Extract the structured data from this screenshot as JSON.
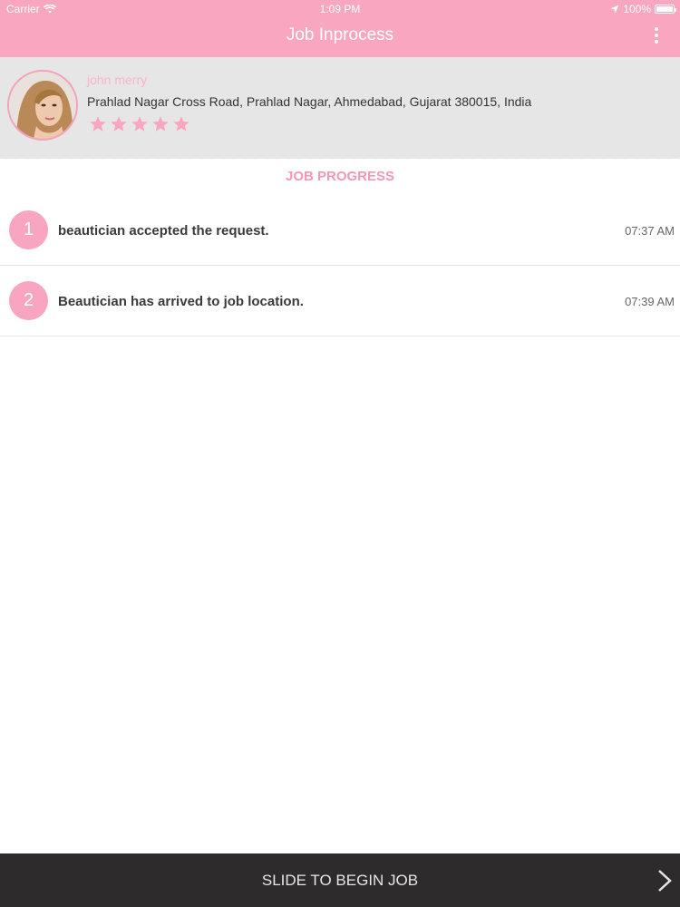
{
  "status_bar": {
    "carrier": "Carrier",
    "time": "1:09 PM",
    "battery": "100%"
  },
  "header": {
    "title": "Job Inprocess",
    "menu_icon": "more-vertical-icon"
  },
  "profile": {
    "name": "john merry",
    "address": "Prahlad Nagar Cross Road,  Prahlad Nagar,  Ahmedabad,  Gujarat 380015,  India",
    "rating": 5,
    "rating_max": 5
  },
  "progress": {
    "title": "JOB PROGRESS",
    "items": [
      {
        "step": "1",
        "text": "beautician accepted the request.",
        "time": "07:37 AM"
      },
      {
        "step": "2",
        "text": "Beautician has arrived to job location.",
        "time": "07:39 AM"
      }
    ]
  },
  "slider": {
    "label": "SLIDE TO BEGIN JOB",
    "icon": "chevron-right-icon"
  },
  "colors": {
    "accent": "#f9a6c0",
    "accent_text": "#f497b5",
    "card_bg": "#e6e6e6",
    "bar_dark": "#2d2b2c"
  }
}
